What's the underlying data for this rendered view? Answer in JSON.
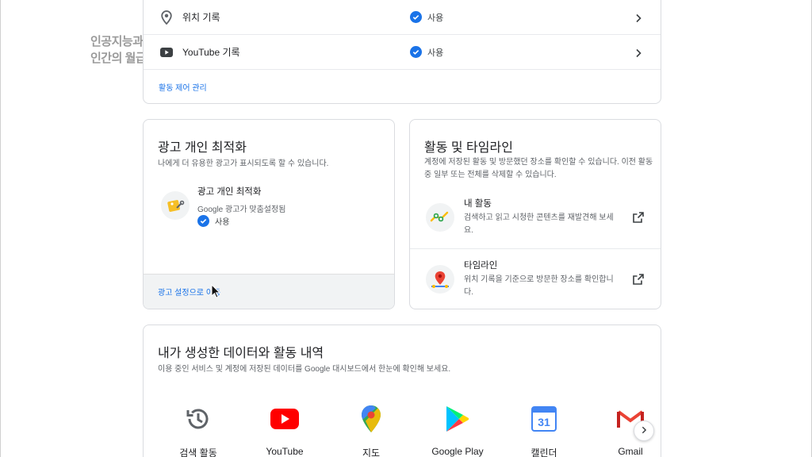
{
  "watermark": {
    "line1": "인공지능과",
    "line2": "인간의 월급"
  },
  "history_rows": [
    {
      "label": "위치 기록",
      "status": "사용",
      "icon": "location-pin-icon"
    },
    {
      "label": "YouTube 기록",
      "status": "사용",
      "icon": "youtube-icon"
    }
  ],
  "history_manage_link": "활동 제어 관리",
  "ads_card": {
    "title": "광고 개인 최적화",
    "description": "나에게 더 유용한 광고가 표시되도록 할 수 있습니다.",
    "item_title": "광고 개인 최적화",
    "item_description": "Google 광고가 맞춤설정됨",
    "item_status": "사용",
    "footer_link": "광고 설정으로 이동"
  },
  "activity_card": {
    "title": "활동 및 타임라인",
    "description": "계정에 저장된 활동 및 방문했던 장소를 확인할 수 있습니다. 이전 활동 중 일부 또는 전체를 삭제할 수 있습니다.",
    "items": [
      {
        "title": "내 활동",
        "description": "검색하고 읽고 시청한 콘텐츠를 재발견해 보세요.",
        "icon": "my-activity-icon"
      },
      {
        "title": "타임라인",
        "description": "위치 기록을 기준으로 방문한 장소를 확인합니다.",
        "icon": "timeline-icon"
      }
    ]
  },
  "data_card": {
    "title": "내가 생성한 데이터와 활동 내역",
    "description": "이용 중인 서비스 및 계정에 저장된 데이터를 Google 대시보드에서 한눈에 확인해 보세요.",
    "services": [
      {
        "label": "검색 활동",
        "icon": "search-history-icon"
      },
      {
        "label": "YouTube",
        "icon": "youtube-icon"
      },
      {
        "label": "지도",
        "icon": "maps-icon"
      },
      {
        "label": "Google Play",
        "icon": "google-play-icon"
      },
      {
        "label": "캘린더",
        "icon": "calendar-icon",
        "badge": "31"
      },
      {
        "label": "Gmail",
        "icon": "gmail-icon"
      }
    ]
  },
  "colors": {
    "accent": "#1a73e8",
    "border": "#dadce0",
    "muted_text": "#5f6368"
  }
}
